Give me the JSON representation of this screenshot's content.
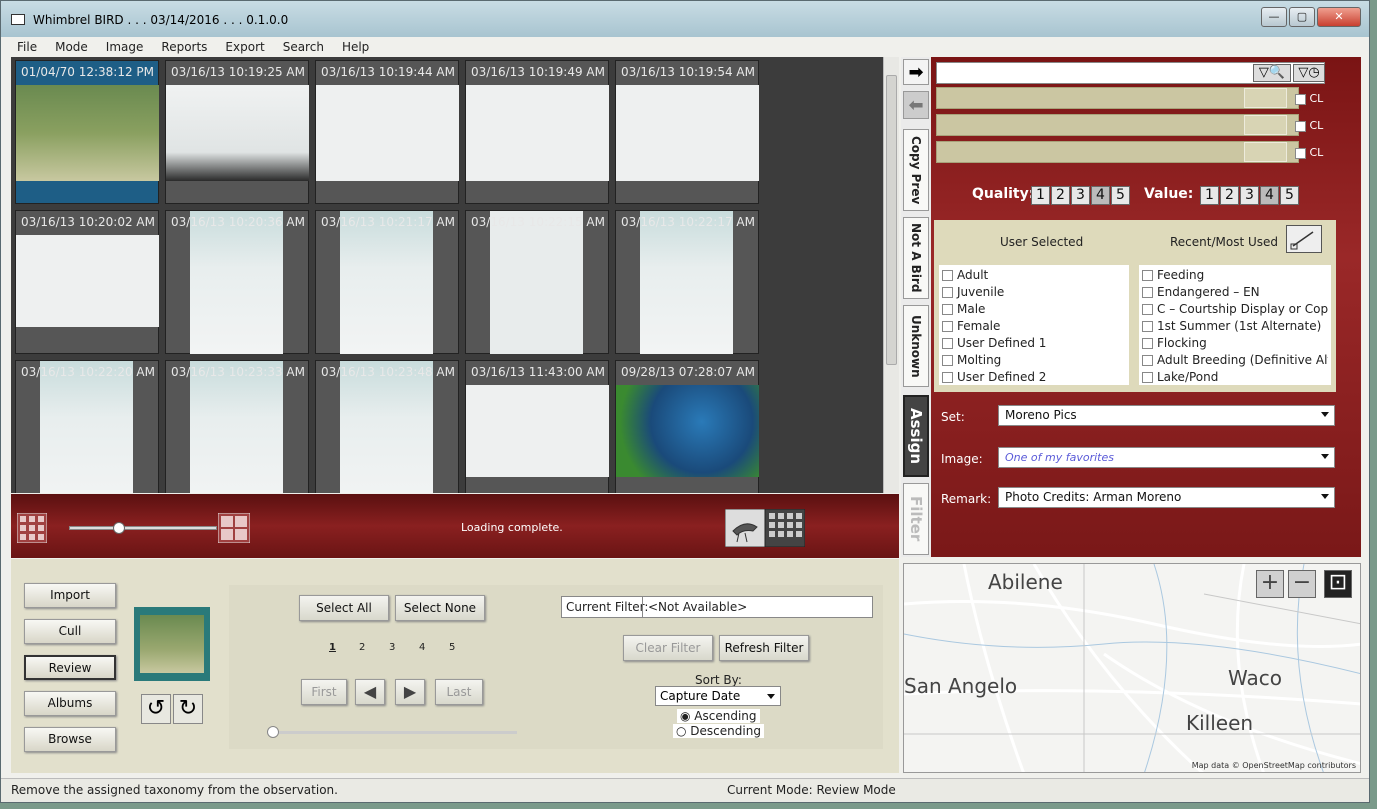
{
  "window": {
    "title": "Whimbrel BIRD . . . 03/14/2016 . . . 0.1.0.0",
    "minimize": "—",
    "maximize": "▢",
    "close": "✕"
  },
  "menu": [
    "File",
    "Mode",
    "Image",
    "Reports",
    "Export",
    "Search",
    "Help"
  ],
  "thumbnails": [
    {
      "ts": "01/04/70 12:38:12 PM"
    },
    {
      "ts": "03/16/13 10:19:25 AM"
    },
    {
      "ts": "03/16/13 10:19:44 AM"
    },
    {
      "ts": "03/16/13 10:19:49 AM"
    },
    {
      "ts": "03/16/13 10:19:54 AM"
    },
    {
      "ts": "03/16/13 10:20:02 AM"
    },
    {
      "ts": "03/16/13 10:20:36 AM"
    },
    {
      "ts": "03/16/13 10:21:17 AM"
    },
    {
      "ts": "03/16/13 10:22:15 AM"
    },
    {
      "ts": "03/16/13 10:22:17 AM"
    },
    {
      "ts": "03/16/13 10:22:20 AM"
    },
    {
      "ts": "03/16/13 10:23:33 AM"
    },
    {
      "ts": "03/16/13 10:23:48 AM"
    },
    {
      "ts": "03/16/13 11:43:00 AM"
    },
    {
      "ts": "09/28/13 07:28:07 AM"
    }
  ],
  "status_loading": "Loading complete.",
  "side_tabs": {
    "copy_prev": "Copy Prev",
    "not_a_bird": "Not A Bird",
    "unknown": "Unknown",
    "assign": "Assign",
    "filter": "Filter"
  },
  "cl_label": "CL",
  "quality": {
    "label": "Quality:",
    "values": [
      "1",
      "2",
      "3",
      "4",
      "5"
    ]
  },
  "value": {
    "label": "Value:",
    "values": [
      "1",
      "2",
      "3",
      "4",
      "5"
    ]
  },
  "tags": {
    "user_selected_header": "User Selected",
    "recent_header": "Recent/Most Used",
    "user_selected": [
      "Adult",
      "Juvenile",
      "Male",
      "Female",
      "User Defined 1",
      "Molting",
      "User Defined 2"
    ],
    "recent": [
      "Feeding",
      "Endangered – EN",
      "C – Courtship Display or Copulati",
      "1st Summer (1st Alternate)",
      "Flocking",
      "Adult Breeding (Definitive Alterna",
      "Lake/Pond"
    ]
  },
  "fields": {
    "set_label": "Set:",
    "set_value": "Moreno Pics",
    "image_label": "Image:",
    "image_placeholder": "One of my favorites",
    "remark_label": "Remark:",
    "remark_value": "Photo Credits: Arman Moreno"
  },
  "map": {
    "cities": [
      "Abilene",
      "San Angelo",
      "Waco",
      "Killeen"
    ],
    "attribution": "Map data © OpenStreetMap contributors",
    "zoom_in": "+",
    "zoom_out": "−",
    "fit": "⊡"
  },
  "nav": {
    "import": "Import",
    "cull": "Cull",
    "review": "Review",
    "albums": "Albums",
    "browse": "Browse"
  },
  "selection": {
    "select_all": "Select All",
    "select_none": "Select None"
  },
  "filter": {
    "current_label": "Current Filter:",
    "current_value": "<Not Available>",
    "clear": "Clear Filter",
    "refresh": "Refresh Filter"
  },
  "pages": [
    "1",
    "2",
    "3",
    "4",
    "5"
  ],
  "paging": {
    "first": "First",
    "last": "Last",
    "prev": "◀",
    "next": "▶"
  },
  "sort": {
    "label": "Sort By:",
    "value": "Capture Date",
    "ascending": "Ascending",
    "descending": "Descending"
  },
  "statusbar": {
    "hint": "Remove the assigned taxonomy from the observation.",
    "mode": "Current Mode: Review Mode"
  },
  "colors": {
    "accent_red": "#8a2020",
    "khaki": "#dedabb",
    "selected_blue": "#1e5e86"
  }
}
